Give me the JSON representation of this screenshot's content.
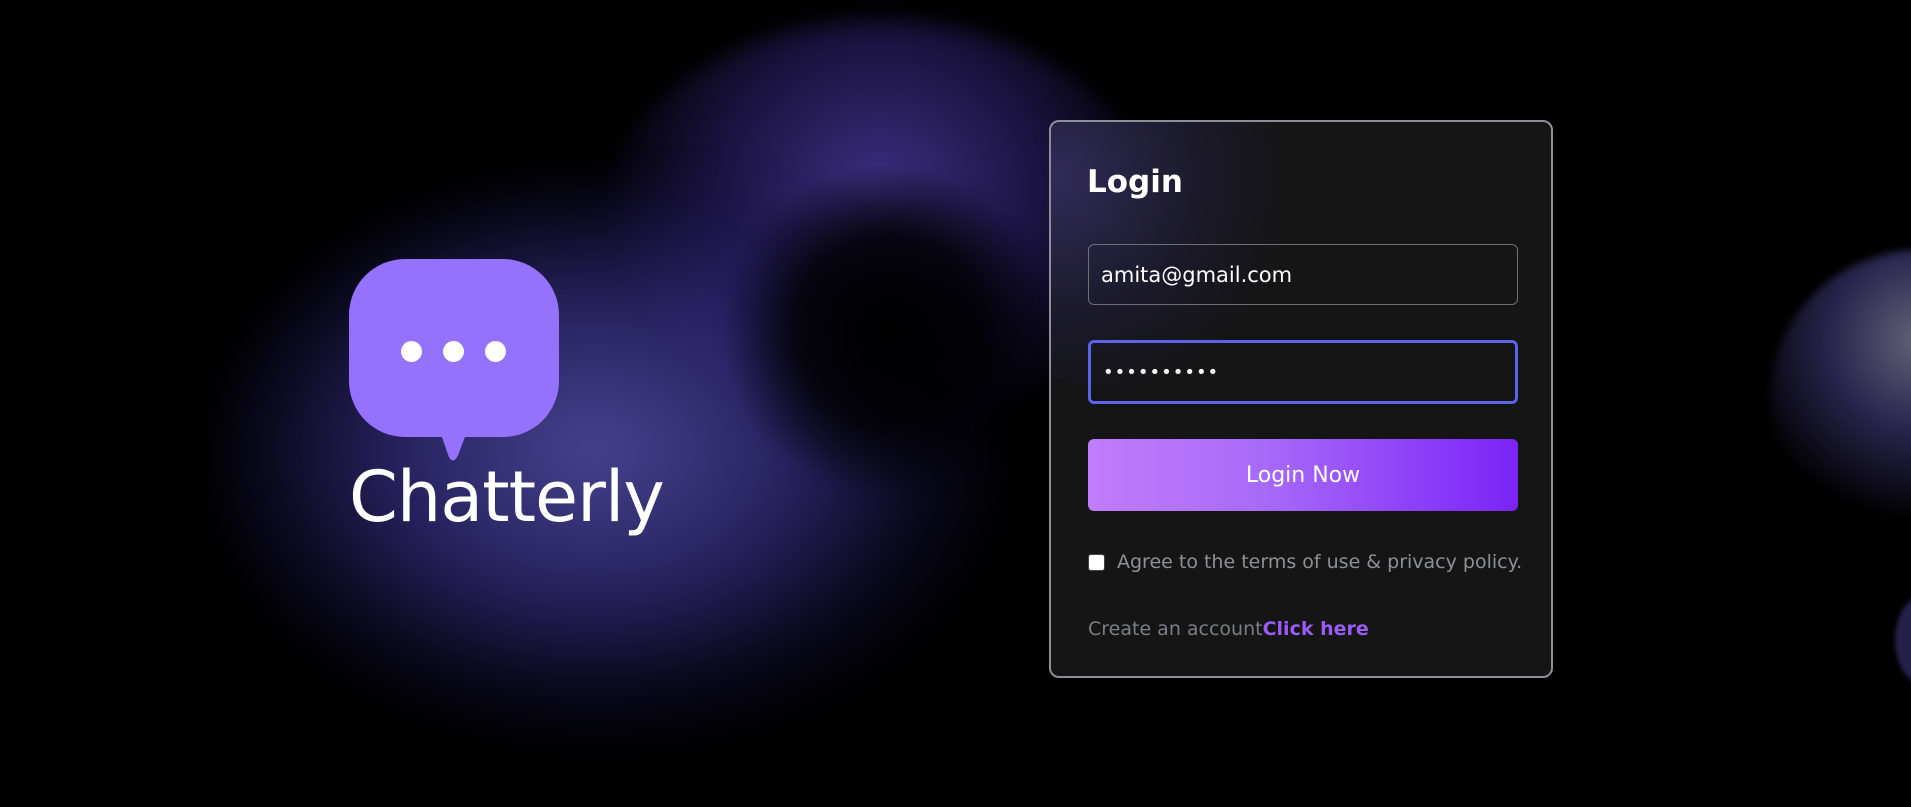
{
  "brand": {
    "name": "Chatterly",
    "logo_icon": "chat-bubble-dots-icon",
    "logo_color": "#9572fb"
  },
  "login": {
    "title": "Login",
    "email_value": "amita@gmail.com",
    "password_value": "••••••••••",
    "button_label": "Login Now",
    "terms_label": "Agree to the terms of use & privacy policy.",
    "terms_checked": false,
    "create_prompt": "Create an account",
    "create_link": "Click here"
  },
  "colors": {
    "accent": "#7b23f7",
    "accent_light": "#c17cfb",
    "focus_border": "#5b63e8",
    "link": "#9a5cf5"
  }
}
